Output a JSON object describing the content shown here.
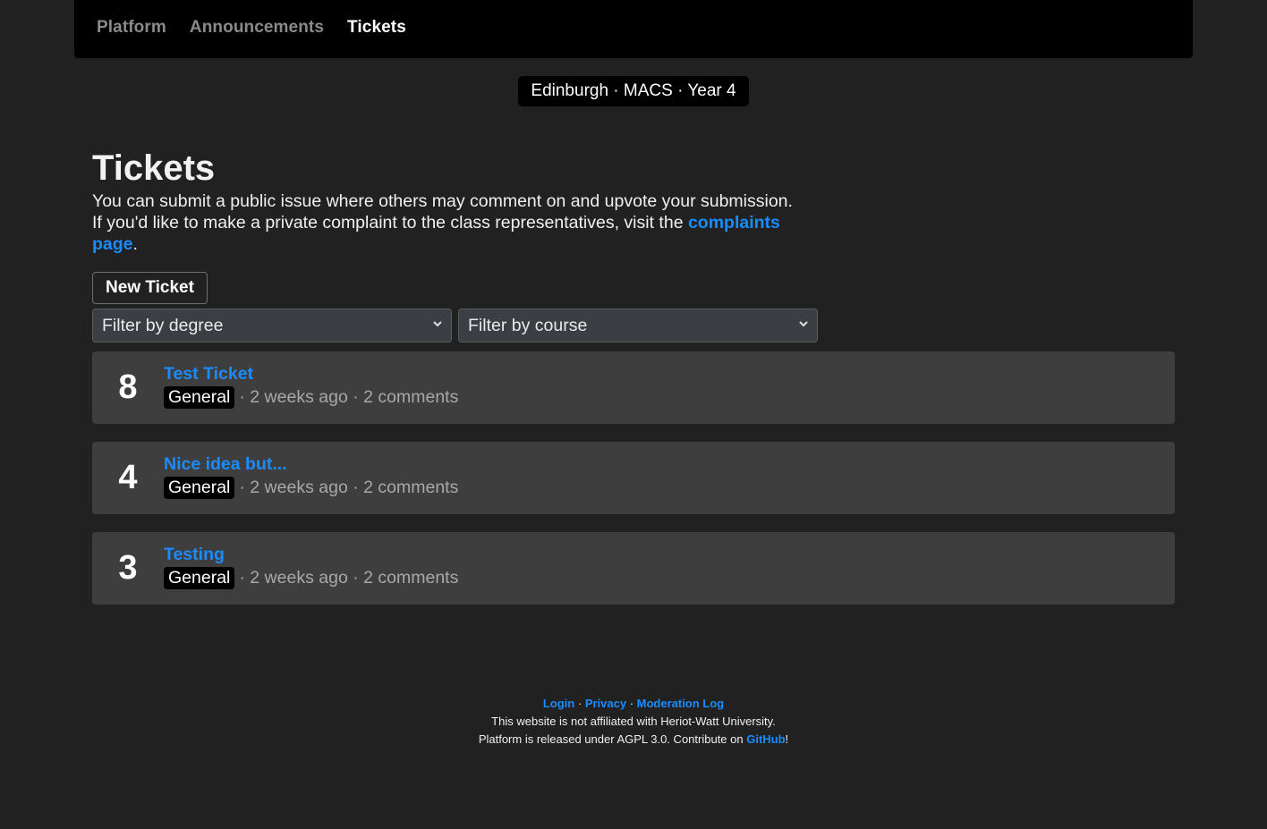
{
  "nav": {
    "items": [
      {
        "label": "Platform",
        "active": false
      },
      {
        "label": "Announcements",
        "active": false
      },
      {
        "label": "Tickets",
        "active": true
      }
    ]
  },
  "context": {
    "label": "Edinburgh · MACS · Year 4"
  },
  "page": {
    "title": "Tickets",
    "intro_before": "You can submit a public issue where others may comment on and upvote your submission. If you'd like to make a private complaint to the class representatives, visit the ",
    "intro_link": "complaints page",
    "intro_after": ".",
    "new_ticket_label": "New Ticket"
  },
  "filters": {
    "degree": {
      "selected": "Filter by degree"
    },
    "course": {
      "selected": "Filter by course"
    }
  },
  "tickets": [
    {
      "score": "8",
      "title": "Test Ticket",
      "tag": "General",
      "age": "2 weeks ago",
      "comments": "2 comments"
    },
    {
      "score": "4",
      "title": "Nice idea but...",
      "tag": "General",
      "age": "2 weeks ago",
      "comments": "2 comments"
    },
    {
      "score": "3",
      "title": "Testing",
      "tag": "General",
      "age": "2 weeks ago",
      "comments": "2 comments"
    }
  ],
  "footer": {
    "links": [
      "Login",
      "Privacy",
      "Moderation Log"
    ],
    "separator": " · ",
    "disclaimer": "This website is not affiliated with Heriot-Watt University.",
    "license_before": "Platform is released under AGPL 3.0. Contribute on ",
    "license_link": "GitHub",
    "license_after": "!"
  },
  "colors": {
    "accent": "#1a8cff",
    "background": "#212121",
    "card": "#3e3e3e",
    "nav": "#000000"
  }
}
